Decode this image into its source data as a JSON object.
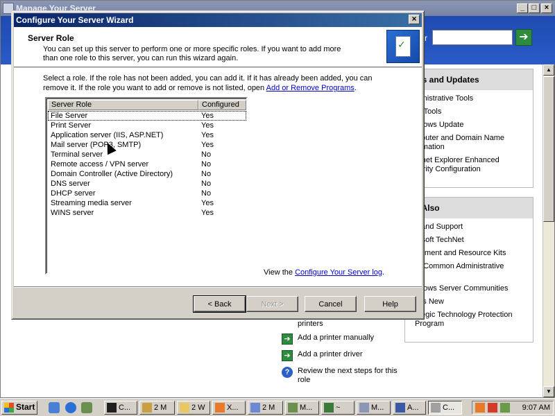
{
  "background_window": {
    "title": "Manage Your Server",
    "search_label": "r",
    "tools_panel": {
      "title": "ols and Updates",
      "items": [
        "ministrative Tools",
        "re Tools",
        "ndows Update",
        "mputer and Domain Name\normation",
        "ernet Explorer Enhanced\ncurity Configuration"
      ]
    },
    "see_also_panel": {
      "title": "e Also",
      "items": [
        "p and Support",
        "rosoft TechNet",
        "loyment and Resource Kits",
        "of Common Administrative\nks",
        "ndows Server Communities",
        "at's New",
        "ategic Technology Protection\nProgram"
      ]
    },
    "tasks": [
      {
        "icon": "green-arrow-icon",
        "text": "printers"
      },
      {
        "icon": "green-arrow-icon",
        "text": "Add a printer manually"
      },
      {
        "icon": "green-arrow-icon",
        "text": "Add a printer driver"
      },
      {
        "icon": "help-icon",
        "text": "Review the next steps for this role"
      }
    ]
  },
  "wizard": {
    "title": "Configure Your Server Wizard",
    "header_title": "Server Role",
    "header_desc": "You can set up this server to perform one or more specific roles. If you want to add more than one role to this server, you can run this wizard again.",
    "instructions_pre": "Select a role. If the role has not been added, you can add it. If it has already been added, you can remove it. If the role you want to add or remove is not listed, open ",
    "instructions_link": "Add or Remove Programs",
    "instructions_post": ".",
    "table": {
      "columns": [
        "Server Role",
        "Configured"
      ],
      "rows": [
        {
          "role": "File Server",
          "configured": "Yes"
        },
        {
          "role": "Print Server",
          "configured": "Yes"
        },
        {
          "role": "Application server (IIS, ASP.NET)",
          "configured": "Yes"
        },
        {
          "role": "Mail server (POP3, SMTP)",
          "configured": "Yes"
        },
        {
          "role": "Terminal server",
          "configured": "No"
        },
        {
          "role": "Remote access / VPN server",
          "configured": "No"
        },
        {
          "role": "Domain Controller (Active Directory)",
          "configured": "No"
        },
        {
          "role": "DNS server",
          "configured": "No"
        },
        {
          "role": "DHCP server",
          "configured": "No"
        },
        {
          "role": "Streaming media server",
          "configured": "Yes"
        },
        {
          "role": "WINS server",
          "configured": "Yes"
        }
      ],
      "selected_index": 0
    },
    "log_pre": "View the ",
    "log_link": "Configure Your Server log",
    "log_post": ".",
    "buttons": {
      "back": "< Back",
      "next": "Next >",
      "cancel": "Cancel",
      "help": "Help"
    }
  },
  "taskbar": {
    "start_label": "Start",
    "tasks": [
      "C...",
      "2 M",
      "2 W",
      "X...",
      "2 M",
      "M...",
      "~",
      "M...",
      "A...",
      "C..."
    ],
    "clock": "9:07 AM"
  }
}
